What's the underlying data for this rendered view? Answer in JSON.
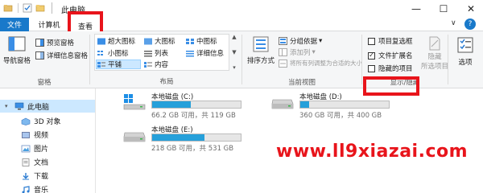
{
  "window": {
    "title": "此电脑",
    "minimize_glyph": "—",
    "maximize_glyph": "☐",
    "close_glyph": "✕"
  },
  "tabs": {
    "file": "文件",
    "computer": "计算机",
    "view": "查看",
    "help_glyph": "?",
    "collapse_glyph": "∨"
  },
  "ribbon": {
    "panes": {
      "label": "窗格",
      "nav_pane": "导航窗格",
      "preview_pane": "预览窗格",
      "details_pane": "详细信息窗格"
    },
    "layout": {
      "label": "布局",
      "items": [
        "超大图标",
        "大图标",
        "中图标",
        "小图标",
        "列表",
        "详细信息",
        "平铺",
        "内容"
      ]
    },
    "current_view": {
      "label": "当前视图",
      "sort_by": "排序方式",
      "group_by": "分组依据",
      "add_columns": "添加列",
      "size_all_columns": "将所有列调整为合适的大小"
    },
    "show_hide": {
      "label": "显示/隐藏",
      "item_checkboxes": "项目复选框",
      "file_extensions": "文件扩展名",
      "hidden_items": "隐藏的项目",
      "hide_selected": "隐藏",
      "hide_selected_2": "所选项目",
      "file_extensions_checked": true,
      "item_checkboxes_checked": false,
      "hidden_items_checked": false
    },
    "options": {
      "label": "选项"
    }
  },
  "navpane": {
    "items": [
      {
        "label": "此电脑"
      },
      {
        "label": "3D 对象"
      },
      {
        "label": "视频"
      },
      {
        "label": "图片"
      },
      {
        "label": "文档"
      },
      {
        "label": "下载"
      },
      {
        "label": "音乐"
      }
    ]
  },
  "drives": [
    {
      "name": "本地磁盘 (C:)",
      "info": "66.2 GB 可用，共 119 GB",
      "used_fraction": 0.44
    },
    {
      "name": "本地磁盘 (D:)",
      "info": "360 GB 可用，共 400 GB",
      "used_fraction": 0.1
    },
    {
      "name": "本地磁盘 (E:)",
      "info": "218 GB 可用，共 531 GB",
      "used_fraction": 0.59
    }
  ],
  "watermark": "www.ll9xiazai.com",
  "colors": {
    "accent": "#1979ca",
    "highlight_red": "#e8141b",
    "drive_bar": "#26a0da"
  }
}
